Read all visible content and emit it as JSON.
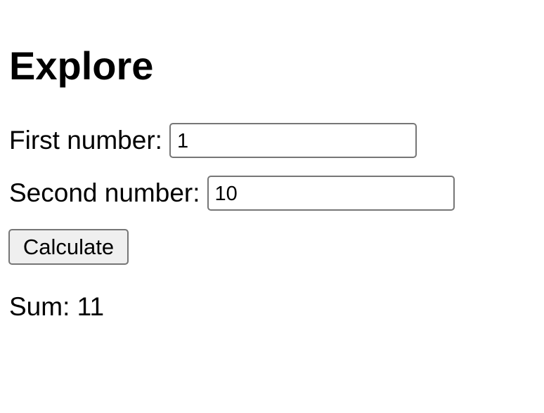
{
  "page": {
    "title": "Explore"
  },
  "form": {
    "first_label": "First number:",
    "first_value": "1",
    "second_label": "Second number:",
    "second_value": "10",
    "calculate_label": "Calculate"
  },
  "result": {
    "label": "Sum:",
    "value": "11"
  }
}
